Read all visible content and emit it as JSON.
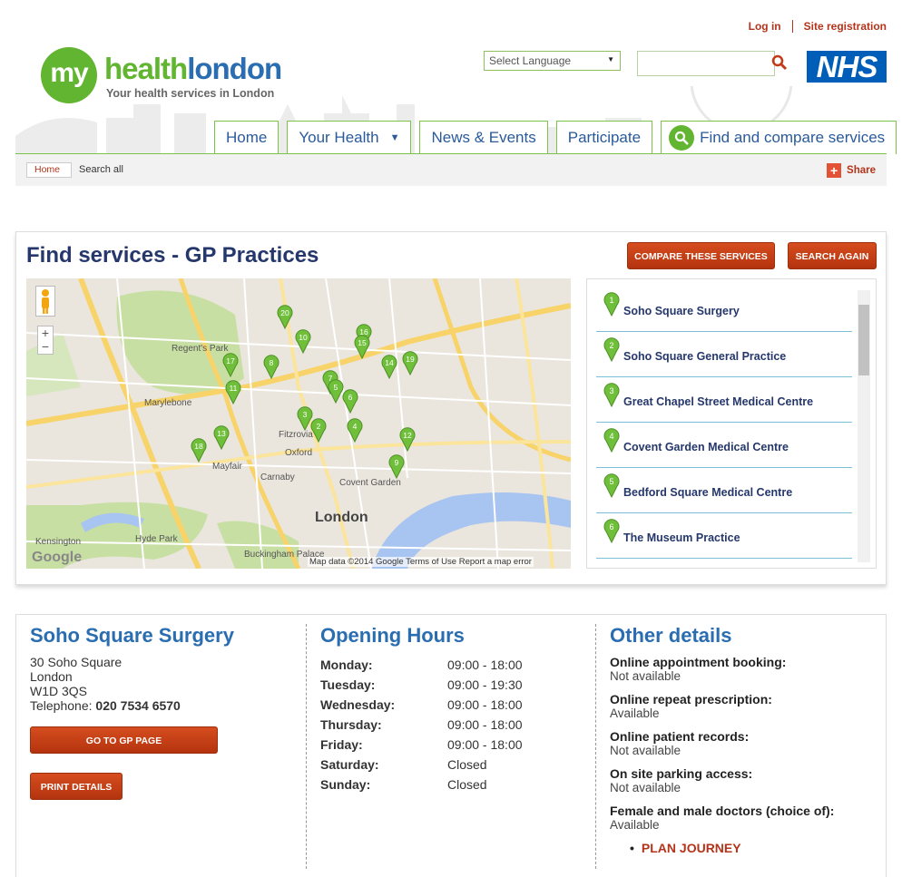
{
  "header": {
    "logo_my": "my",
    "logo_health": "health",
    "logo_london": "london",
    "logo_tagline": "Your health services in London",
    "login": "Log in",
    "site_registration": "Site registration",
    "language_select": "Select Language",
    "search_placeholder": "",
    "nhs": "NHS"
  },
  "nav": {
    "home": "Home",
    "your_health": "Your Health",
    "news_events": "News & Events",
    "participate": "Participate",
    "find_compare": "Find and compare services"
  },
  "breadcrumb": {
    "home": "Home",
    "current": "Search all",
    "share": "Share"
  },
  "services": {
    "title": "Find services - GP Practices",
    "compare_button": "COMPARE THESE SERVICES",
    "search_again_button": "SEARCH AGAIN",
    "list": [
      {
        "num": "1",
        "name": "Soho Square Surgery"
      },
      {
        "num": "2",
        "name": "Soho Square General Practice"
      },
      {
        "num": "3",
        "name": "Great Chapel Street Medical Centre"
      },
      {
        "num": "4",
        "name": "Covent Garden Medical Centre"
      },
      {
        "num": "5",
        "name": "Bedford Square Medical Centre"
      },
      {
        "num": "6",
        "name": "The Museum Practice"
      }
    ],
    "map": {
      "attribution": "Map data ©2014 Google   Terms of Use   Report a map error",
      "google": "Google",
      "labels": [
        "Regent's Park",
        "Marylebone",
        "London",
        "Mayfair",
        "Hyde Park",
        "Kensington",
        "Buckingham Palace",
        "Covent Garden",
        "Carnaby",
        "Fitzrovia",
        "Oxford"
      ],
      "pins": [
        "20",
        "10",
        "16",
        "15",
        "17",
        "8",
        "14",
        "19",
        "11",
        "7",
        "5",
        "6",
        "3",
        "2",
        "4",
        "12",
        "13",
        "18",
        "9"
      ]
    }
  },
  "detail": {
    "name": "Soho Square Surgery",
    "address1": "30 Soho Square",
    "address2": "London",
    "postcode": "W1D 3QS",
    "telephone_label": "Telephone: ",
    "telephone": "020 7534 6570",
    "gp_page_button": "GO TO GP PAGE",
    "print_button": "PRINT DETAILS",
    "hours_title": "Opening Hours",
    "hours": [
      {
        "day": "Monday:",
        "time": "09:00 - 18:00"
      },
      {
        "day": "Tuesday:",
        "time": "09:00 - 19:30"
      },
      {
        "day": "Wednesday:",
        "time": "09:00 - 18:00"
      },
      {
        "day": "Thursday:",
        "time": "09:00 - 18:00"
      },
      {
        "day": "Friday:",
        "time": "09:00 - 18:00"
      },
      {
        "day": "Saturday:",
        "time": "Closed"
      },
      {
        "day": "Sunday:",
        "time": "Closed"
      }
    ],
    "other_title": "Other details",
    "other": [
      {
        "k": "Online appointment booking:",
        "v": "Not available"
      },
      {
        "k": "Online repeat prescription:",
        "v": "Available"
      },
      {
        "k": "Online patient records:",
        "v": "Not available"
      },
      {
        "k": "On site parking access:",
        "v": "Not available"
      },
      {
        "k": "Female and male doctors (choice of):",
        "v": "Available"
      }
    ],
    "plan_journey": "PLAN JOURNEY"
  }
}
